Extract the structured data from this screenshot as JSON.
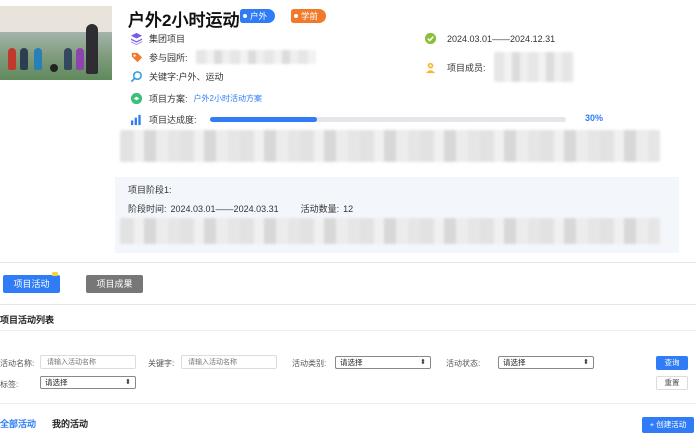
{
  "project": {
    "title": "户外2小时运动",
    "tags": [
      {
        "label": "户外",
        "color": "#2f7cf6"
      },
      {
        "label": "学前",
        "color": "#f07a2a"
      }
    ],
    "type_label": "集团项目",
    "schools_label": "参与园所:",
    "keywords_label": "关键字:",
    "keywords_value": "户外、运动",
    "plan_label": "项目方案:",
    "plan_link": "户外2小时活动方案",
    "progress_label": "项目达成度:",
    "progress_value": 30,
    "progress_text": "30%",
    "date_range": "2024.03.01——2024.12.31",
    "members_label": "项目成员:"
  },
  "stage": {
    "title": "项目阶段1:",
    "time_label": "阶段时间:",
    "time_value": "2024.03.01——2024.03.31",
    "count_label": "活动数量:",
    "count_value": "12"
  },
  "tabs_top": {
    "activities": "项目活动",
    "results": "项目成果"
  },
  "list": {
    "section_title": "项目活动列表",
    "filters": {
      "name_label": "活动名称:",
      "name_placeholder": "请输入活动名称",
      "keyword_label": "关键字:",
      "keyword_placeholder": "请输入活动名称",
      "category_label": "活动类别:",
      "category_value": "请选择",
      "status_label": "活动状态:",
      "status_value": "请选择",
      "tag_label": "标签:",
      "tag_value": "请选择"
    },
    "search_button": "查询",
    "reset_button": "重置",
    "tab_all": "全部活动",
    "tab_mine": "我的活动",
    "create_button": "+ 创建活动"
  },
  "colors": {
    "accent": "#2f7cf6",
    "orange": "#f07a2a",
    "gray_button": "#777777"
  }
}
